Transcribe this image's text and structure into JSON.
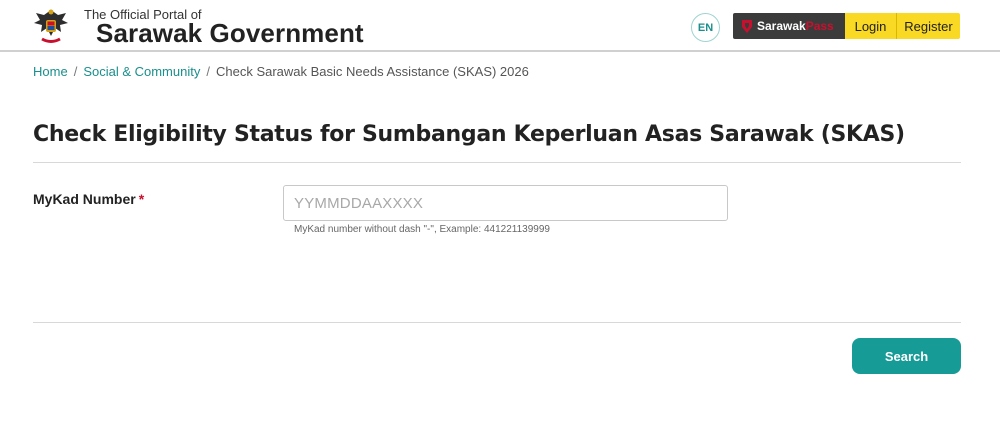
{
  "header": {
    "portal_small": "The Official Portal of",
    "portal_big": "Sarawak Government",
    "logo_icon": "sarawak-coat-of-arms-icon",
    "lang": "EN",
    "sarawakpass": {
      "brand_primary": "Sarawak",
      "brand_secondary": "Pass",
      "login": "Login",
      "register": "Register"
    }
  },
  "breadcrumb": {
    "items": [
      "Home",
      "Social & Community",
      "Check Sarawak Basic Needs Assistance (SKAS) 2026"
    ],
    "separator": "/"
  },
  "form": {
    "title": "Check Eligibility Status for Sumbangan Keperluan Asas Sarawak (SKAS)",
    "mykad_label": "MyKad Number",
    "required_mark": "*",
    "mykad_value": "",
    "mykad_placeholder": "YYMMDDAAXXXX",
    "mykad_hint": "MyKad number without dash \"-\", Example: 441221139999",
    "search_label": "Search"
  },
  "colors": {
    "accent": "#169b97",
    "link": "#1a8f8c",
    "required": "#c8102e",
    "sarawakpass_yellow": "#f9d923",
    "sarawakpass_dark": "#3b3b3b"
  }
}
